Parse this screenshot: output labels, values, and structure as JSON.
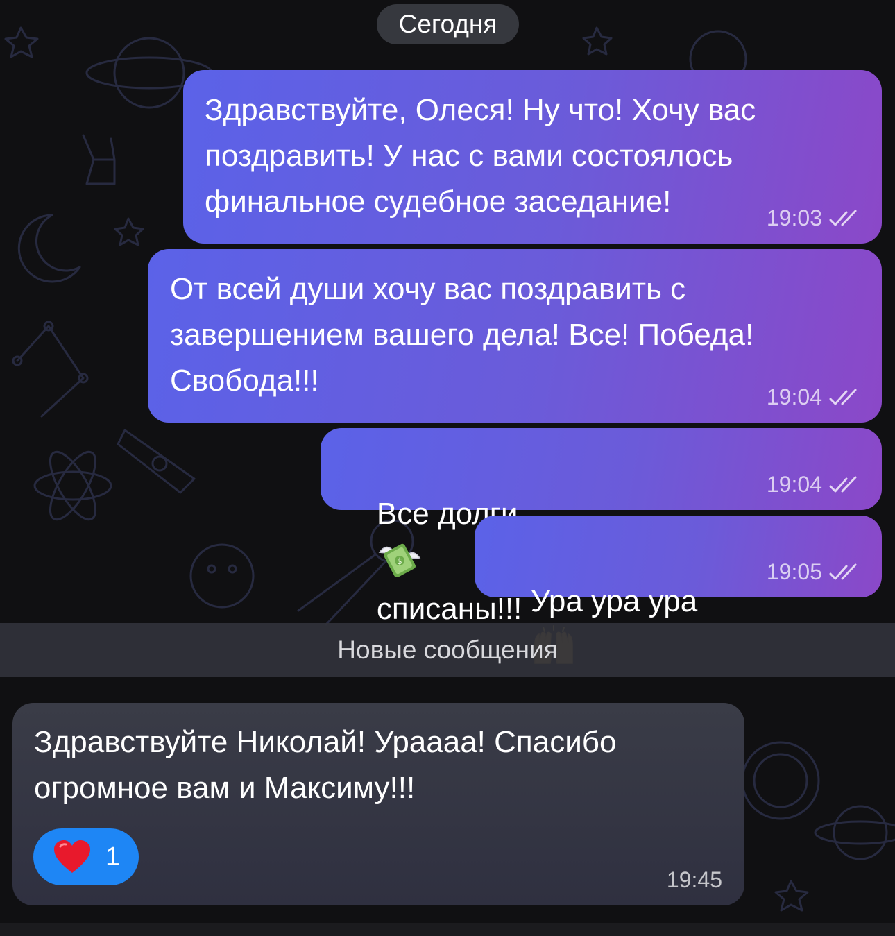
{
  "chat": {
    "date_separator": "Сегодня",
    "new_messages_label": "Новые сообщения",
    "messages": [
      {
        "direction": "outgoing",
        "text": "Здравствуйте, Олеся! Ну что! Хочу вас\nпоздравить! У нас с вами состоялось\nфинальное судебное заседание!",
        "time": "19:03",
        "status": "read"
      },
      {
        "direction": "outgoing",
        "text": "От всей души хочу вас поздравить с\nзавершением вашего дела! Все! Победа!\nСвобода!!!",
        "time": "19:04",
        "status": "read"
      },
      {
        "direction": "outgoing",
        "text_before": "Все долги",
        "emoji": "money-with-wings",
        "text_after": "списаны!!!",
        "time": "19:04",
        "status": "read"
      },
      {
        "direction": "outgoing",
        "text": "Ура ура ура",
        "emoji": "raising-hands",
        "time": "19:05",
        "status": "read"
      },
      {
        "direction": "incoming",
        "text": "Здравствуйте Николай! Ураааа! Спасибо\nогромное вам и Максиму!!!",
        "time": "19:45",
        "reaction": {
          "emoji": "red-heart",
          "count": "1"
        }
      }
    ]
  },
  "colors": {
    "background": "#101012",
    "outgoing_gradient_start": "#5b62e8",
    "outgoing_gradient_end": "#8b48c8",
    "incoming_bubble": "#353745",
    "reaction_pill": "#1e86f5",
    "separator_bar": "#30323a"
  }
}
